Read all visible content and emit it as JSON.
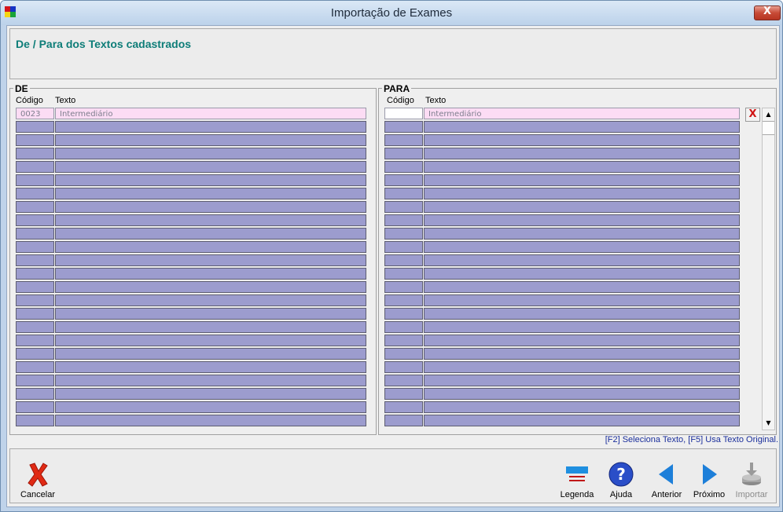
{
  "window": {
    "title": "Importação de Exames",
    "close_glyph": "X"
  },
  "header": {
    "heading": "De / Para dos Textos cadastrados"
  },
  "de": {
    "legend": "DE",
    "col_codigo": "Código",
    "col_texto": "Texto",
    "rows": [
      {
        "codigo": "0023",
        "texto": "Intermediário"
      }
    ]
  },
  "para": {
    "legend": "PARA",
    "col_codigo": "Código",
    "col_texto": "Texto",
    "rows": [
      {
        "codigo": "",
        "texto": "Intermediário"
      }
    ],
    "delete_glyph": "X"
  },
  "grid": {
    "visible_rows": 24,
    "row_color": "#9c9cce",
    "selected_row_color": "#fcdcf4"
  },
  "hint": "[F2] Seleciona Texto, [F5] Usa Texto Original.",
  "toolbar": {
    "cancel_label": "Cancelar",
    "cancel_icon": "red-x-icon",
    "legend_label": "Legenda",
    "legend_icon": "legend-icon",
    "help_label": "Ajuda",
    "help_icon": "help-icon",
    "previous_label": "Anterior",
    "previous_icon": "arrow-left-icon",
    "next_label": "Próximo",
    "next_icon": "arrow-right-icon",
    "import_label": "Importar",
    "import_icon": "import-icon",
    "import_enabled": false
  },
  "colors": {
    "heading": "#0d7d78",
    "hint": "#1b2f9c",
    "accent_blue": "#1f6fce",
    "cancel_red": "#e02a14"
  }
}
